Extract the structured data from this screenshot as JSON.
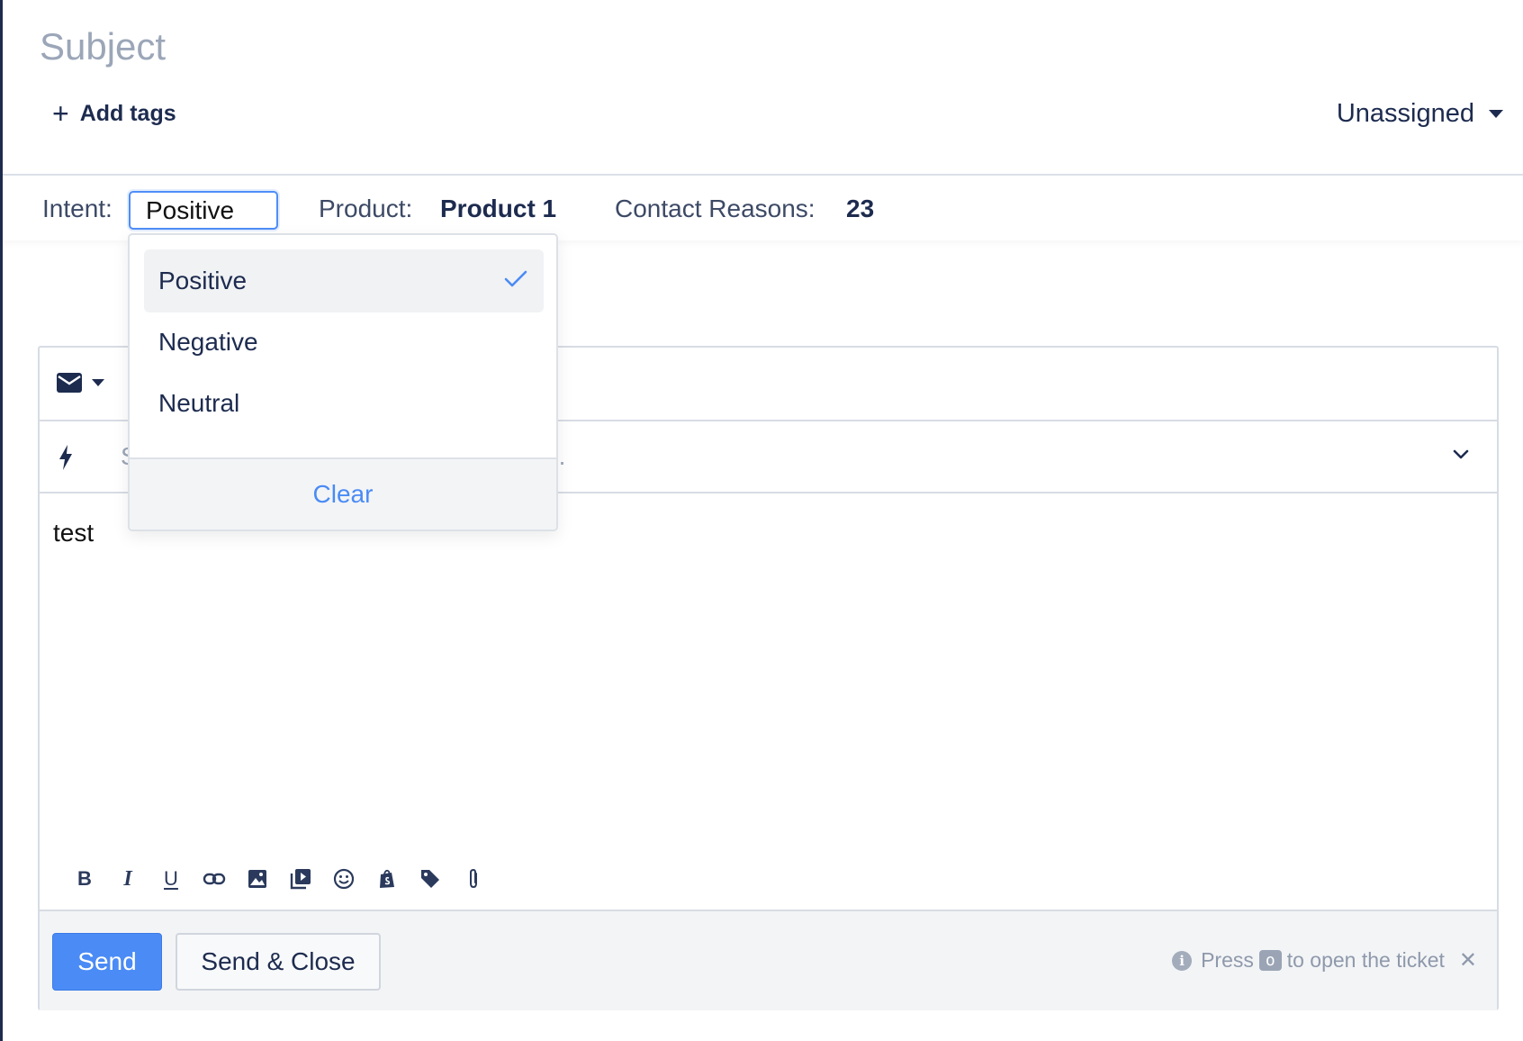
{
  "ticket": {
    "subject_placeholder": "Subject",
    "add_tags_label": "Add tags",
    "assignee_label": "Unassigned"
  },
  "fields": {
    "intent_label": "Intent:",
    "intent_value": "Positive",
    "product_label": "Product:",
    "product_value": "Product 1",
    "contact_reasons_label": "Contact Reasons:",
    "contact_reasons_value": "23"
  },
  "intent_dropdown": {
    "options": [
      {
        "label": "Positive",
        "selected": true
      },
      {
        "label": "Negative",
        "selected": false
      },
      {
        "label": "Neutral",
        "selected": false
      }
    ],
    "clear_label": "Clear"
  },
  "composer": {
    "channel_icon": "mail-icon",
    "macro_icon": "bolt-icon",
    "macro_placeholder": "Search macros by name, tags or body...",
    "body_text": "test",
    "format_buttons": [
      "bold",
      "italic",
      "underline",
      "link",
      "image",
      "video",
      "emoji",
      "shopify",
      "tag",
      "attachment"
    ],
    "send_label": "Send",
    "send_close_label": "Send & Close",
    "hint_prefix": "Press",
    "hint_key": "o",
    "hint_suffix": "to open the ticket"
  },
  "colors": {
    "primary": "#4a8bf5",
    "text_dark": "#1d2b4f",
    "muted": "#9ba6b8",
    "border": "#d7dce4",
    "footer_bg": "#f3f4f6"
  }
}
